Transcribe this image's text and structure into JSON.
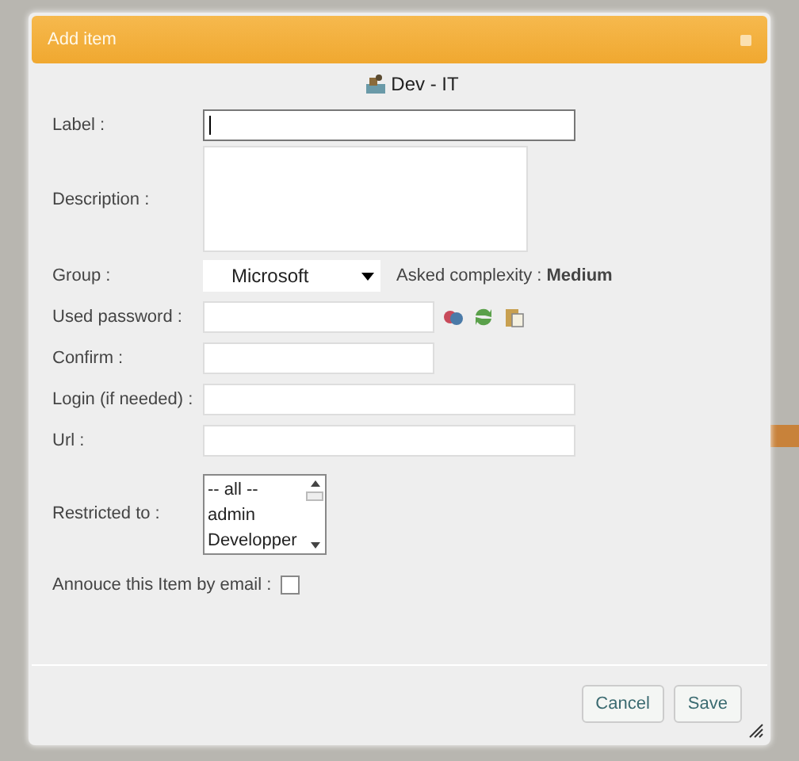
{
  "dialog": {
    "title": "Add item",
    "folder": "Dev - IT",
    "fields": [
      {
        "kind": "text",
        "label": "Label :",
        "focused": true
      },
      {
        "kind": "textarea",
        "label": "Description :",
        "focused": false
      },
      {
        "kind": "select",
        "label": "Group :",
        "value": "Microsoft",
        "note": "Asked complexity : **Medium**",
        "focused": false
      },
      {
        "kind": "password",
        "label": "Used password :",
        "focused": false
      },
      {
        "kind": "short",
        "label": "Confirm :",
        "focused": false
      },
      {
        "kind": "text",
        "label": "Login (if needed) :",
        "focused": false
      },
      {
        "kind": "text",
        "label": "Url :",
        "focused": false
      },
      {
        "kind": "listbox",
        "label": "Restricted to :",
        "options": [
          {
            "label": "-- all --",
            "selected": false
          },
          {
            "label": "admin",
            "selected": false
          },
          {
            "label": "Developper",
            "selected": false
          }
        ],
        "focused": false
      },
      {
        "kind": "checkbox",
        "label": "Annouce this Item by email :",
        "checked": false,
        "focused": false
      }
    ],
    "buttons": [
      "Cancel",
      "Save"
    ]
  }
}
